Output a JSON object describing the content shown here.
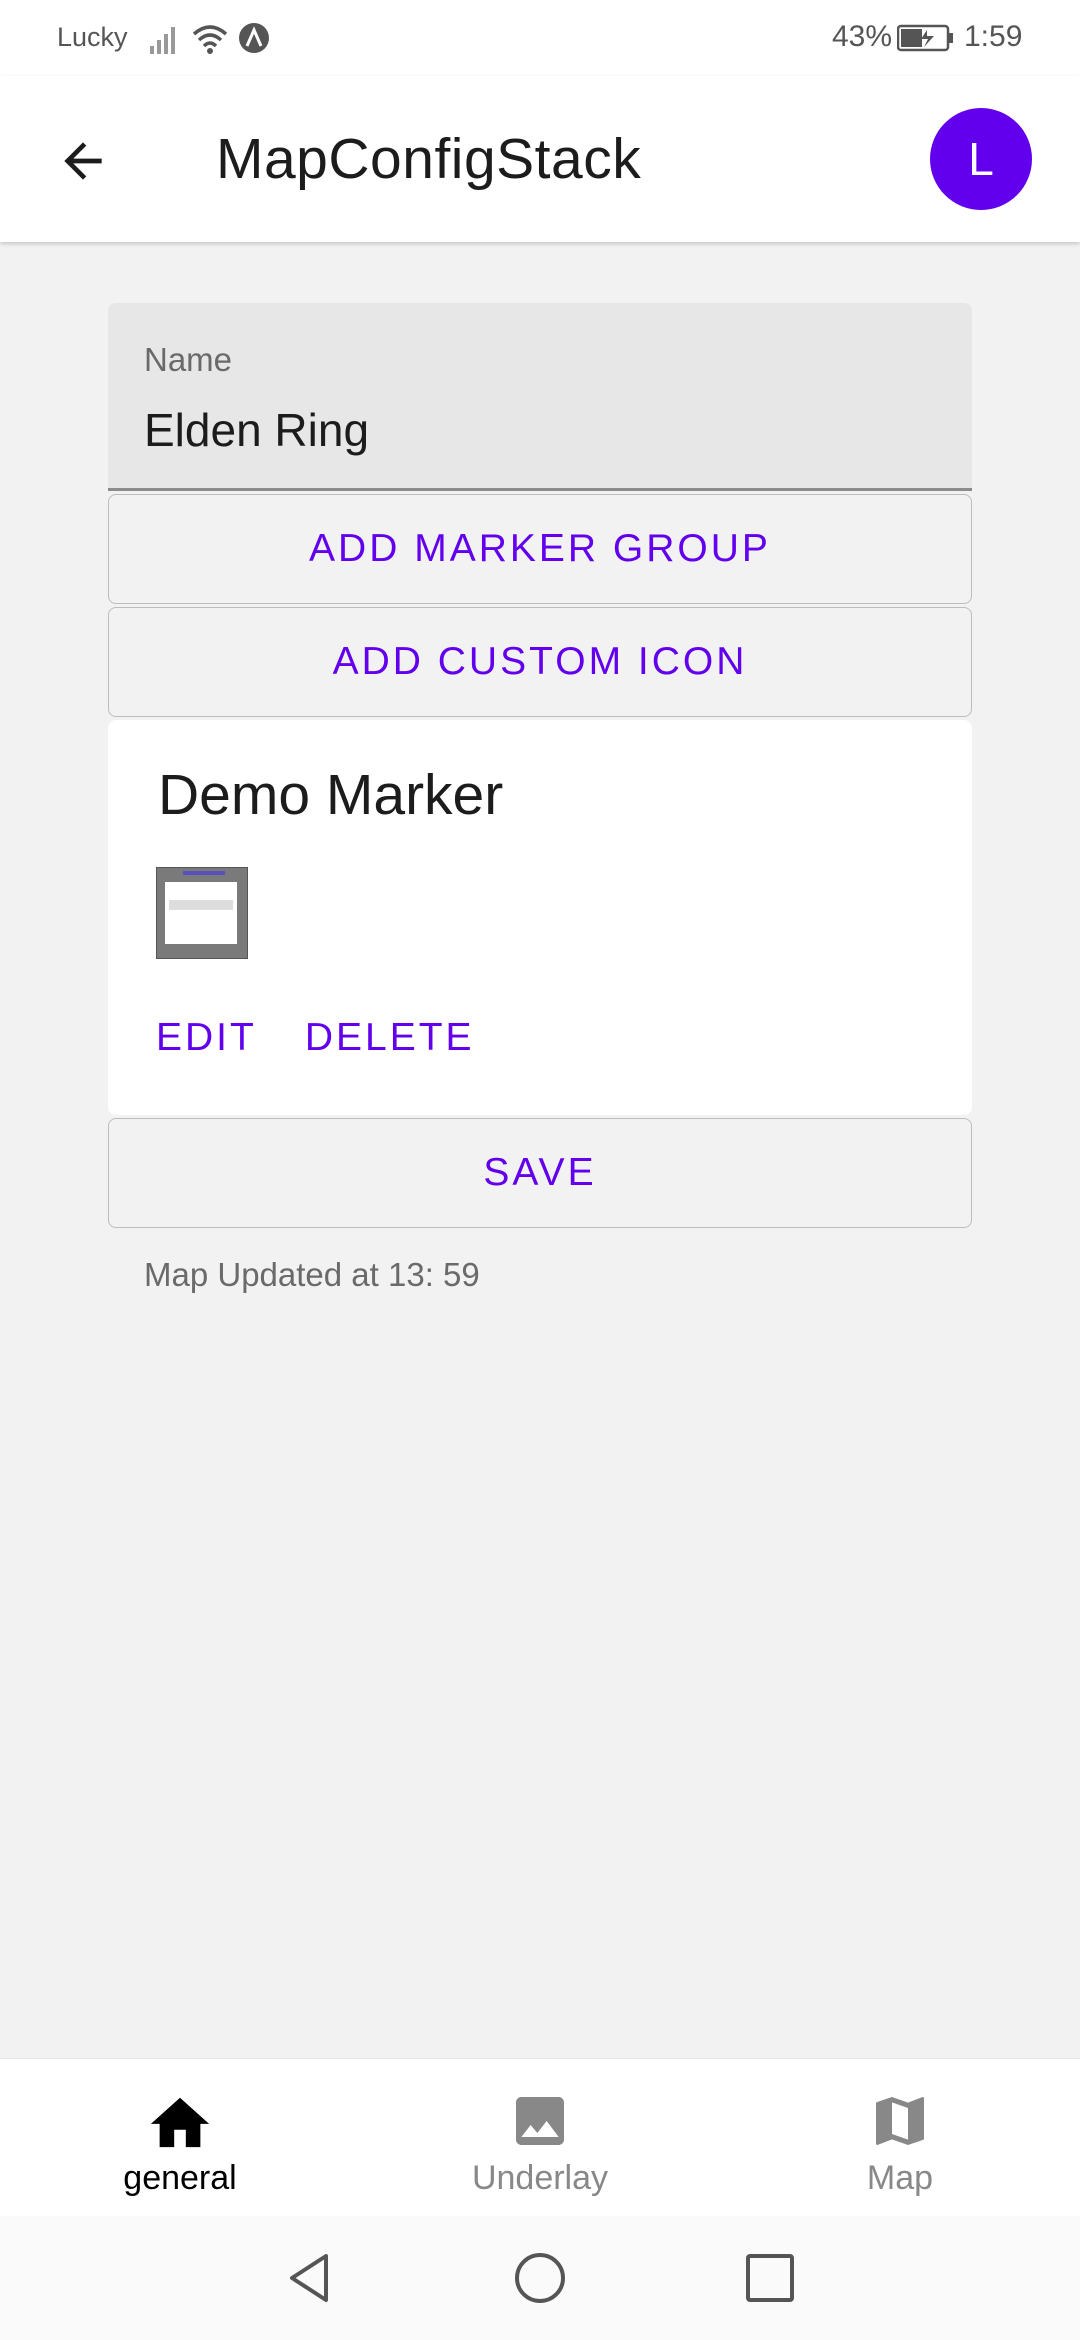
{
  "status_bar": {
    "carrier": "Lucky",
    "battery": "43%",
    "time": "1:59"
  },
  "app_bar": {
    "title": "MapConfigStack",
    "avatar_initial": "L"
  },
  "form": {
    "name_label": "Name",
    "name_value": "Elden Ring",
    "add_marker_group": "ADD MARKER GROUP",
    "add_custom_icon": "ADD CUSTOM ICON"
  },
  "marker_card": {
    "title": "Demo Marker",
    "edit_label": "EDIT",
    "delete_label": "DELETE"
  },
  "save_label": "SAVE",
  "update_status": "Map Updated at 13: 59",
  "bottom_nav": {
    "items": [
      {
        "label": "general",
        "icon": "home-icon",
        "active": true
      },
      {
        "label": "Underlay",
        "icon": "image-icon",
        "active": false
      },
      {
        "label": "Map",
        "icon": "map-icon",
        "active": false
      }
    ]
  },
  "colors": {
    "primary": "#6200ee",
    "background": "#f2f2f2"
  }
}
